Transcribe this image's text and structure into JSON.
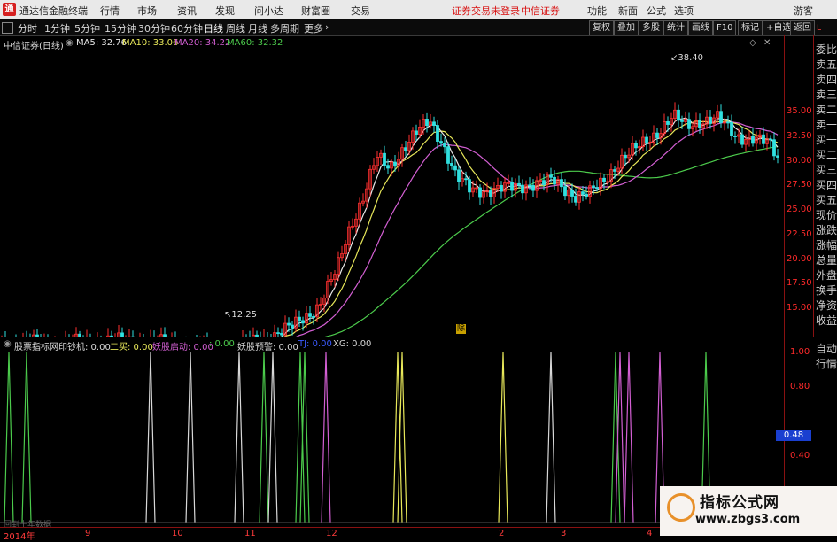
{
  "titlebar": {
    "logo_char": "通",
    "app_name": "通达信金融终端",
    "menus": [
      "行情",
      "市场",
      "资讯",
      "发现",
      "问小达",
      "财富圈",
      "交易"
    ],
    "notice": "证券交易未登录",
    "broker": "中信证券",
    "right_items": [
      "功能",
      "新面",
      "公式",
      "选项"
    ],
    "guest": "游客"
  },
  "periods": [
    "分时",
    "1分钟",
    "5分钟",
    "15分钟",
    "30分钟",
    "60分钟",
    "日线",
    "周线",
    "月线",
    "多周期",
    "更多"
  ],
  "active_period": "日线",
  "right_tools": [
    "复权",
    "叠加",
    "多股",
    "统计",
    "画线",
    "F10",
    "标记",
    "+自选",
    "返回"
  ],
  "stock": {
    "name": "中信证券(日线)"
  },
  "ma": [
    {
      "label": "MA5: 32.76",
      "color": "#e8e8e8"
    },
    {
      "label": "MA10: 33.06",
      "color": "#e8e85a"
    },
    {
      "label": "MA20: 34.22",
      "color": "#d35fd3"
    },
    {
      "label": "MA60: 32.32",
      "color": "#4ccb4c"
    }
  ],
  "annotations": {
    "high": "38.40",
    "low": "12.25",
    "flag": "除"
  },
  "price_axis": [
    "35.00",
    "32.50",
    "30.00",
    "27.50",
    "25.00",
    "22.50",
    "20.00",
    "17.50",
    "15.00"
  ],
  "right_list": [
    "委比",
    "卖五",
    "卖四",
    "卖三",
    "卖二",
    "卖一",
    "买一",
    "买二",
    "买三",
    "买四",
    "买五",
    "现价",
    "涨跌",
    "涨幅",
    "总量",
    "外盘",
    "换手",
    "净资",
    "收益"
  ],
  "right_list_bottom": [
    "自动",
    "行情"
  ],
  "indicator": {
    "name": "股票指标网",
    "items": [
      {
        "label": "印钞机: 0.00",
        "color": "#d8d8d8"
      },
      {
        "label": "二买: 0.00",
        "color": "#e8e85a"
      },
      {
        "label": "妖股启动: 0.00",
        "color": "#d35fd3"
      },
      {
        "label": ": 0.00",
        "color": "#4ccb4c"
      },
      {
        "label": "妖股预警: 0.00",
        "color": "#d8d8d8"
      },
      {
        "label": "TJ: 0.00",
        "color": "#3b5bff"
      },
      {
        "label": "XG: 0.00",
        "color": "#d8d8d8"
      }
    ],
    "axis": [
      "1.00",
      "0.80",
      "0.48",
      "0.40"
    ],
    "highlight": "0.48",
    "footnote": "回到十年数据"
  },
  "xaxis": [
    "2014年",
    "9",
    "10",
    "11",
    "12",
    "2",
    "3",
    "4"
  ],
  "watermark": {
    "title": "指标公式网",
    "url": "www.zbgs3.com"
  },
  "colors": {
    "up": "#ff3030",
    "down": "#30e0e0",
    "grid": "#8a1111",
    "ma5": "#e8e8e8",
    "ma10": "#e8e85a",
    "ma20": "#d35fd3",
    "ma60": "#4ccb4c"
  }
}
